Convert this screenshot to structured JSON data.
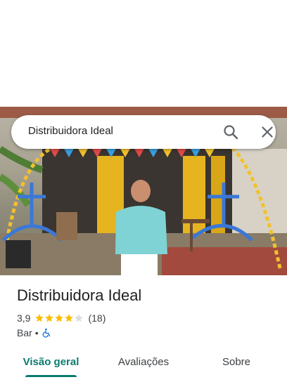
{
  "search": {
    "query": "Distribuidora Ideal",
    "search_icon": "search-icon",
    "close_icon": "close-icon"
  },
  "place": {
    "name": "Distribuidora Ideal",
    "rating": "3,9",
    "stars_filled": 4,
    "stars_total": 5,
    "review_count": "(18)",
    "category": "Bar",
    "separator": "•",
    "accessibility_icon": "wheelchair-icon"
  },
  "tabs": [
    {
      "label": "Visão geral",
      "active": true
    },
    {
      "label": "Avaliações",
      "active": false
    },
    {
      "label": "Sobre",
      "active": false
    }
  ],
  "colors": {
    "accent": "#0b7b6f",
    "star": "#fbbc04",
    "star_empty": "#dadce0",
    "accessibility": "#1a73e8"
  }
}
